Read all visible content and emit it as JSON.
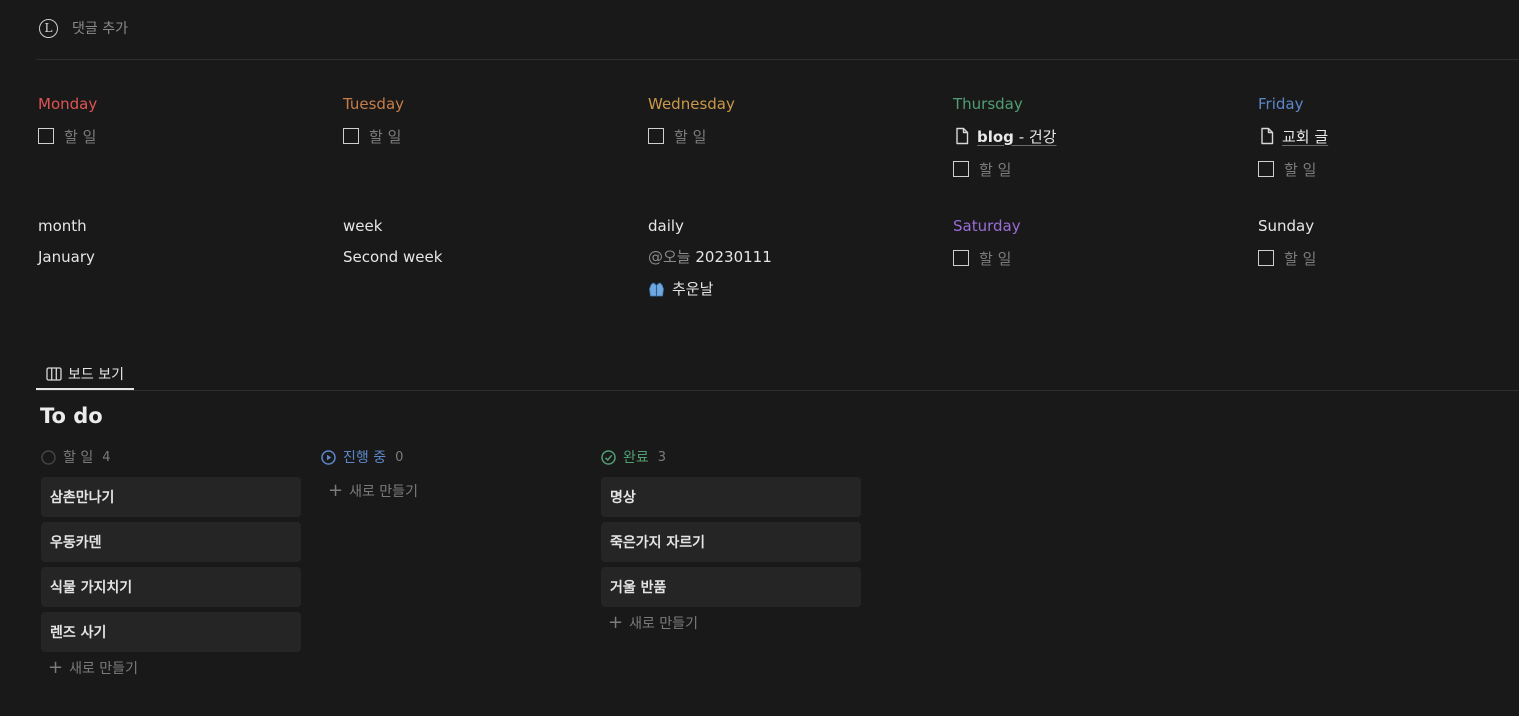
{
  "comment": {
    "avatar_letter": "L",
    "add_label": "댓글 추가"
  },
  "week": {
    "days": [
      {
        "name": "Monday",
        "color": "#df5452",
        "docs": [],
        "todo_placeholder": "할 일"
      },
      {
        "name": "Tuesday",
        "color": "#c77d48",
        "docs": [],
        "todo_placeholder": "할 일"
      },
      {
        "name": "Wednesday",
        "color": "#ca9849",
        "docs": [],
        "todo_placeholder": "할 일"
      },
      {
        "name": "Thursday",
        "color": "#529e72",
        "docs": [
          {
            "bold": "blog",
            "rest": " - 건강"
          }
        ],
        "todo_placeholder": "할 일"
      },
      {
        "name": "Friday",
        "color": "#5e87c9",
        "docs": [
          {
            "bold": "",
            "rest": "교회 글"
          }
        ],
        "todo_placeholder": "할 일"
      }
    ]
  },
  "info": {
    "month_label": "month",
    "month_value": "January",
    "week_label": "week",
    "week_value": "Second week",
    "daily_label": "daily",
    "daily_at": "@오늘",
    "daily_date": "20230111",
    "daily_weather_icon": "coat-emoji",
    "daily_weather": "추운날",
    "saturday": {
      "name": "Saturday",
      "color": "#9a6dd7",
      "todo_placeholder": "할 일"
    },
    "sunday": {
      "name": "Sunday",
      "todo_placeholder": "할 일"
    }
  },
  "board": {
    "tab_label": "보드 보기",
    "title": "To do",
    "groups": [
      {
        "name": "할 일",
        "count": "4",
        "color": "#9b9b9b",
        "icon": "circle-empty-icon",
        "cards": [
          "삼촌만나기",
          "우동카덴",
          "식물 가지치기",
          "렌즈 사기"
        ],
        "new_label": "새로 만들기"
      },
      {
        "name": "진행 중",
        "count": "0",
        "color": "#5e87c9",
        "icon": "in-progress-icon",
        "cards": [],
        "new_label": "새로 만들기"
      },
      {
        "name": "완료",
        "count": "3",
        "color": "#529e72",
        "icon": "check-circle-icon",
        "cards": [
          "명상",
          "죽은가지 자르기",
          "거울 반품"
        ],
        "new_label": "새로 만들기"
      }
    ]
  }
}
